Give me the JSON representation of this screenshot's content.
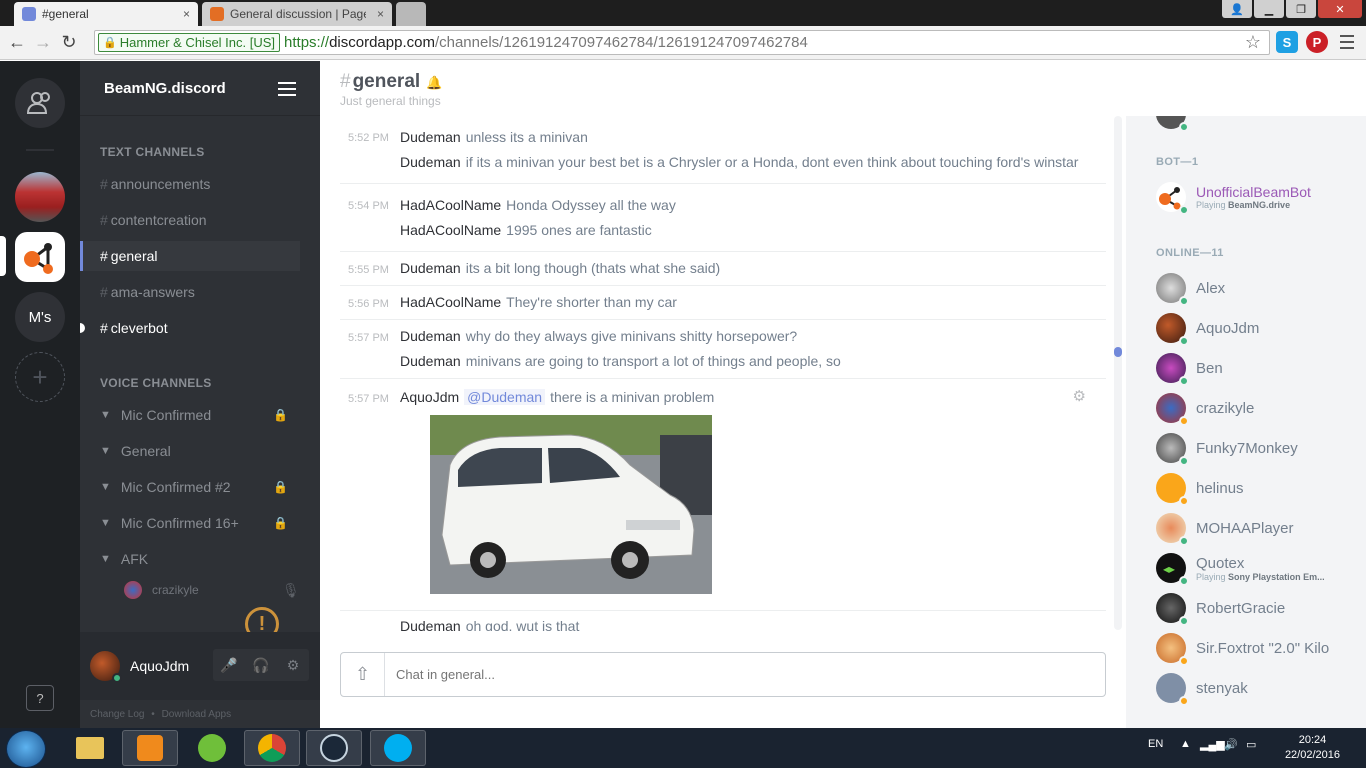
{
  "browser": {
    "tabs": [
      {
        "title": "#general",
        "close": "×"
      },
      {
        "title": "General discussion | Page",
        "close": "×"
      }
    ],
    "cert_label": "Hammer & Chisel Inc. [US]",
    "url": {
      "scheme": "https://",
      "host": "discordapp.com",
      "path": "/channels/126191247097462784/126191247097462784"
    },
    "extensions": [
      {
        "letter": "S",
        "color": "#1fa0e3"
      },
      {
        "letter": "P",
        "color": "#cb2027"
      }
    ]
  },
  "guilds": [
    {
      "name": "friends-guild",
      "label": ""
    },
    {
      "name": "car-guild",
      "label": ""
    },
    {
      "name": "beamng-guild",
      "label": ""
    },
    {
      "name": "ms-guild",
      "label": "M's"
    }
  ],
  "help_label": "?",
  "sidebar": {
    "server_name": "BeamNG.discord",
    "text_header": "TEXT CHANNELS",
    "text_channels": [
      {
        "hash": "#",
        "name": "announcements"
      },
      {
        "hash": "#",
        "name": "contentcreation"
      },
      {
        "hash": "#",
        "name": "general"
      },
      {
        "hash": "#",
        "name": "ama-answers"
      },
      {
        "hash": "#",
        "name": "cleverbot"
      }
    ],
    "voice_header": "VOICE CHANNELS",
    "voice_channels": [
      {
        "name": "Mic Confirmed"
      },
      {
        "name": "General"
      },
      {
        "name": "Mic Confirmed #2"
      },
      {
        "name": "Mic Confirmed 16+"
      },
      {
        "name": "AFK"
      }
    ],
    "voice_user": "crazikyle",
    "user": {
      "name": "AquoJdm"
    },
    "footer": {
      "changelog": "Change Log",
      "sep": "•",
      "download": "Download Apps"
    },
    "warn": "!"
  },
  "channel": {
    "hash": "#",
    "name": "general",
    "topic": "Just general things"
  },
  "messages": [
    {
      "time": "5:52 PM",
      "lines": [
        {
          "author": "Dudeman",
          "text": "unless its a minivan"
        },
        {
          "author": "Dudeman",
          "text": "if its a minivan your best bet is a Chrysler or a Honda, dont even think about touching ford's winstar"
        }
      ]
    },
    {
      "time": "5:54 PM",
      "lines": [
        {
          "author": "HadACoolName",
          "text": "Honda Odyssey all the way"
        },
        {
          "author": "HadACoolName",
          "text": "1995 ones are fantastic"
        }
      ]
    },
    {
      "time": "5:55 PM",
      "lines": [
        {
          "author": "Dudeman",
          "text": "its a bit long though (thats what she said)"
        }
      ]
    },
    {
      "time": "5:56 PM",
      "lines": [
        {
          "author": "HadACoolName",
          "text": "They're shorter than my car"
        }
      ]
    },
    {
      "time": "5:57 PM",
      "lines": [
        {
          "author": "Dudeman",
          "text": "why do they always give minivans shitty horsepower?"
        },
        {
          "author": "Dudeman",
          "text": "minivans are going to transport a lot of things and people, so"
        }
      ]
    },
    {
      "time": "5:57 PM",
      "lines": [
        {
          "author": "AquoJdm",
          "mention": "@Dudeman",
          "text": "there is a minivan problem"
        }
      ]
    },
    {
      "time": "",
      "lines": [
        {
          "author": "Dudeman",
          "text": "oh god, wut is that"
        }
      ]
    }
  ],
  "chat": {
    "placeholder": "Chat in general..."
  },
  "members": {
    "bot_header": "BOT—1",
    "bot": {
      "name": "UnofficialBeamBot",
      "playing_prefix": "Playing",
      "game": "BeamNG.drive"
    },
    "online_header": "ONLINE—11",
    "online": [
      {
        "name": "Alex",
        "status": "#43b581"
      },
      {
        "name": "AquoJdm",
        "status": "#43b581"
      },
      {
        "name": "Ben",
        "status": "#43b581"
      },
      {
        "name": "crazikyle",
        "status": "#faa61a"
      },
      {
        "name": "Funky7Monkey",
        "status": "#43b581"
      },
      {
        "name": "helinus",
        "status": "#faa61a"
      },
      {
        "name": "MOHAAPlayer",
        "status": "#43b581"
      },
      {
        "name": "Quotex",
        "status": "#43b581",
        "playing_prefix": "Playing",
        "game": "Sony Playstation Em..."
      },
      {
        "name": "RobertGracie",
        "status": "#43b581"
      },
      {
        "name": "Sir.Foxtrot \"2.0\" Kilo",
        "status": "#faa61a"
      },
      {
        "name": "stenyak",
        "status": "#faa61a"
      }
    ]
  },
  "taskbar": {
    "lang": "EN",
    "time": "20:24",
    "date": "22/02/2016"
  },
  "colors": {
    "accent": "#7289da",
    "online": "#43b581",
    "idle": "#faa61a",
    "bot_name": "#9b59b6"
  }
}
